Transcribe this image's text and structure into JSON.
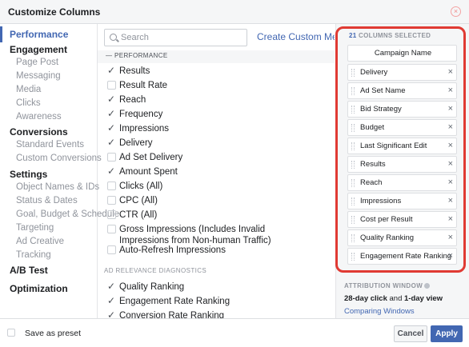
{
  "header": {
    "title": "Customize Columns",
    "close_icon": "close-circle-icon"
  },
  "nav": {
    "performance": "Performance",
    "engagement": "Engagement",
    "engagement_items": [
      "Page Post",
      "Messaging",
      "Media",
      "Clicks",
      "Awareness"
    ],
    "conversions": "Conversions",
    "conversions_items": [
      "Standard Events",
      "Custom Conversions"
    ],
    "settings": "Settings",
    "settings_items": [
      "Object Names & IDs",
      "Status & Dates",
      "Goal, Budget & Schedule",
      "Targeting",
      "Ad Creative",
      "Tracking"
    ],
    "ab_test": "A/B Test",
    "optimization": "Optimization"
  },
  "search": {
    "placeholder": "Search",
    "value": ""
  },
  "create_custom_metric": "Create Custom Metric",
  "performance_section": {
    "label": "— PERFORMANCE",
    "items": [
      {
        "label": "Results",
        "checked": true
      },
      {
        "label": "Result Rate",
        "checked": false
      },
      {
        "label": "Reach",
        "checked": true
      },
      {
        "label": "Frequency",
        "checked": true
      },
      {
        "label": "Impressions",
        "checked": true
      },
      {
        "label": "Delivery",
        "checked": true
      },
      {
        "label": "Ad Set Delivery",
        "checked": false
      },
      {
        "label": "Amount Spent",
        "checked": true
      },
      {
        "label": "Clicks (All)",
        "checked": false
      },
      {
        "label": "CPC (All)",
        "checked": false
      },
      {
        "label": "CTR (All)",
        "checked": false
      },
      {
        "label": "Gross Impressions (Includes Invalid Impressions from Non-human Traffic)",
        "checked": false
      },
      {
        "label": "Auto-Refresh Impressions",
        "checked": false
      }
    ]
  },
  "diagnostics_section": {
    "label": "AD RELEVANCE DIAGNOSTICS",
    "items": [
      {
        "label": "Quality Ranking",
        "checked": true
      },
      {
        "label": "Engagement Rate Ranking",
        "checked": true
      },
      {
        "label": "Conversion Rate Ranking",
        "checked": true
      }
    ]
  },
  "selected": {
    "count": "21",
    "count_suffix": "COLUMNS SELECTED",
    "fixed": "Campaign Name",
    "columns": [
      "Delivery",
      "Ad Set Name",
      "Bid Strategy",
      "Budget",
      "Last Significant Edit",
      "Results",
      "Reach",
      "Impressions",
      "Cost per Result",
      "Quality Ranking",
      "Engagement Rate Ranking"
    ],
    "remove_glyph": "×"
  },
  "attribution": {
    "title": "ATTRIBUTION WINDOW",
    "click": "28-day click",
    "and": "and",
    "view": "1-day view",
    "link": "Comparing Windows"
  },
  "footer": {
    "preset": "Save as preset",
    "cancel": "Cancel",
    "apply": "Apply"
  },
  "colors": {
    "accent": "#4267b2",
    "highlight": "#e03a33"
  }
}
